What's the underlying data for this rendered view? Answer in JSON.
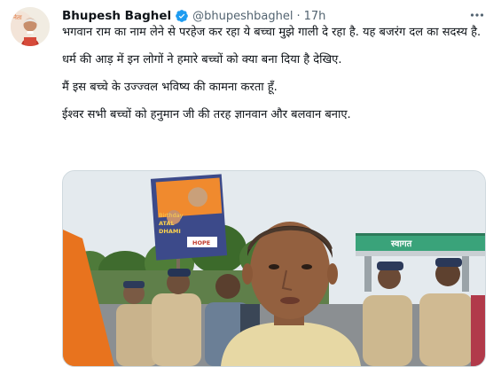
{
  "author": {
    "name": "Bhupesh Baghel",
    "handle": "@bhupeshbaghel",
    "time": "17h",
    "avatar_label": "नेता",
    "verified_icon": "verified-badge-icon"
  },
  "tweet": {
    "paragraphs": [
      "भगवान राम का नाम लेने से परहेज कर रहा ये बच्चा मुझे गाली दे रहा है. यह बजरंग दल का सदस्य है.",
      "धर्म की आड़ में इन लोगों ने हमारे बच्चों को क्या बना दिया है देखिए.",
      "मैं इस बच्चे के उज्ज्वल भविष्य की कामना करता हूँ.",
      "ईश्वर सभी बच्चों को हनुमान जी की तरह ज्ञानवान और बलवान बनाए."
    ]
  },
  "media": {
    "billboard_lines": [
      "Birthday",
      "ATAL",
      "DHAMI"
    ],
    "billboard_tag": "HOPE",
    "gate_sign": "स्वागत"
  },
  "colors": {
    "accent": "#1d9bf0",
    "text": "#0f1419",
    "secondary": "#536471",
    "border": "#cfd9de"
  },
  "icons": {
    "more": "more-options-icon"
  }
}
